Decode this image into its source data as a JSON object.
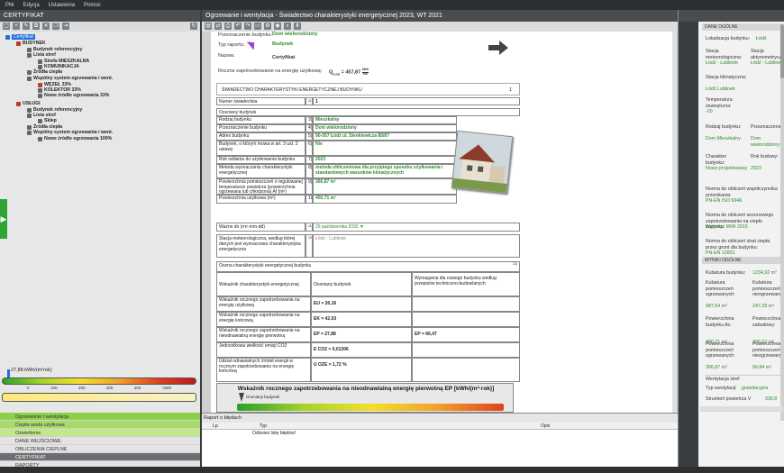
{
  "menubar": [
    "Plik",
    "Edycja",
    "Ustawienia",
    "Pomoc"
  ],
  "left": {
    "title": "CERTYFIKAT",
    "tree": [
      {
        "label": "Certyfikat",
        "indent": 0,
        "bold": false,
        "selected": true,
        "color": "#1e6fd9"
      },
      {
        "label": "BUDYNEK",
        "indent": 1,
        "bold": true,
        "color": "#c0392b"
      },
      {
        "label": "Budynek referencyjny",
        "indent": 2,
        "bold": true,
        "color": "#666"
      },
      {
        "label": "Lista stref",
        "indent": 2,
        "bold": true,
        "color": "#666"
      },
      {
        "label": "Strefa  MIESZKALNA",
        "indent": 3,
        "bold": true,
        "color": "#666"
      },
      {
        "label": "KOMUNIKACJA",
        "indent": 3,
        "bold": true,
        "color": "#666"
      },
      {
        "label": "Źródła ciepła",
        "indent": 2,
        "bold": true,
        "color": "#666"
      },
      {
        "label": "Wspólny system ogrzewania i went.",
        "indent": 2,
        "bold": true,
        "color": "#666"
      },
      {
        "label": "WĘZEŁ 33%",
        "indent": 3,
        "bold": true,
        "color": "#c0392b"
      },
      {
        "label": "KOLEKTOR 33%",
        "indent": 3,
        "bold": true,
        "color": "#666"
      },
      {
        "label": "Nowe źródło ogrzewania 33%",
        "indent": 3,
        "bold": true,
        "color": "#666"
      },
      {
        "label": "USŁUGI",
        "indent": 1,
        "bold": true,
        "color": "#c0392b"
      },
      {
        "label": "Budynek referencyjny",
        "indent": 2,
        "bold": true,
        "color": "#666"
      },
      {
        "label": "Lista stref",
        "indent": 2,
        "bold": true,
        "color": "#666"
      },
      {
        "label": "Sklep",
        "indent": 3,
        "bold": true,
        "color": "#666"
      },
      {
        "label": "Źródła ciepła",
        "indent": 2,
        "bold": true,
        "color": "#666"
      },
      {
        "label": "Wspólny system ogrzewania i went.",
        "indent": 2,
        "bold": true,
        "color": "#666"
      },
      {
        "label": "Nowe źródło ogrzewania 100%",
        "indent": 3,
        "bold": true,
        "color": "#666"
      }
    ],
    "scale_label": "27,88 kWh/(m²rok)",
    "scale_ticks": [
      "0",
      "100",
      "200",
      "300",
      "400",
      ">500"
    ],
    "nav": [
      {
        "label": "Ogrzewanie i wentylacja",
        "style": "g1"
      },
      {
        "label": "Ciepła woda użytkowa",
        "style": "g2"
      },
      {
        "label": "Oświetlenie",
        "style": "g3"
      },
      {
        "label": "DANE WEJŚCIOWE",
        "style": "n"
      },
      {
        "label": "OBLICZENIA CIEPLNE",
        "style": "n"
      },
      {
        "label": "CERTYFIKAT",
        "style": "dk"
      },
      {
        "label": "RAPORTY",
        "style": "n"
      }
    ]
  },
  "main": {
    "title": "Ogrzewanie i wentylacja - Świadectwo charakterystyki energetycznej 2023, WT 2021",
    "fields": {
      "przeznaczenie_label": "Przeznaczenie budynku:",
      "przeznaczenie_value": "Dom wielorodzinny",
      "typ_label": "Typ raportu:",
      "typ_value": "Budynek",
      "nazwa_label": "Nazwa:",
      "nazwa_value": "Certyfikat",
      "roczne_label": "Roczne zapotrzebowanie na energię użytkową:",
      "roczne_value": "Q",
      "roczne_sub": "H,nd",
      "roczne_rest": "= 457,87",
      "roczne_unit_top": "kWh",
      "roczne_unit_bot": "rok"
    },
    "doc": {
      "header_title": "ŚWIADECTWO CHARAKTERYSTYKI ENERGETYCZNEJ BUDYNKU",
      "header_num": "1",
      "numer_label": "Numer świadectwa",
      "numer_idx": "2)",
      "numer_value": "1",
      "oceniany": "Oceniany budynek",
      "rows": [
        {
          "label": "Rodzaj budynku",
          "idx": "3)",
          "value": "Mieszkalny"
        },
        {
          "label": "Przeznaczenie budynku",
          "idx": "4)",
          "value": "Dom wielorodzinny"
        },
        {
          "label": "Adres budynku",
          "idx": "5)",
          "value": "90-057 Łódź ul. Sienkiewicza 85/87"
        },
        {
          "label": "Budynek, o którym mowa w art. 3 ust. 2 ustawy",
          "idx": "6)",
          "value": "Nie"
        },
        {
          "label": "Rok oddania do użytkowania budynku",
          "idx": "7)",
          "value": "2023"
        },
        {
          "label": "Metoda wyznaczania charakterystyki energetycznej",
          "idx": "8)",
          "value": "metoda obliczeniowa dla przyjętego sposobu użytkowania i standardowych warunków klimatycznych"
        },
        {
          "label": "Powierzchnia pomieszczeń o regulowanej temperaturze powietrza (powierzchnia ogrzewana lub chłodzona) Af (m²)",
          "idx": "9)",
          "value": "366,87 m²"
        },
        {
          "label": "Powierzchnia użytkowa (m²)",
          "idx": "10)",
          "value": "450,71 m²"
        }
      ],
      "wazne_label": "Ważne do (rrrr-mm-dd)",
      "wazne_idx": "11)",
      "wazne_value": "25 października 2032",
      "stacja_label": "Stacja meteorologiczna, według której danych jest wyznaczana charakterystyka energetyczna",
      "stacja_idx": "12)",
      "stacja_value": "Łódź - Lublinek",
      "ocena_title": "Ocena charakterystyki energetycznej budynku",
      "ocena_num": "13)",
      "table_head": [
        "Wskaźnik charakterystyki energetycznej",
        "Oceniany budynek",
        "Wymagania dla nowego budynku według przepisów techniczno-budowlanych"
      ],
      "table_rows": [
        {
          "label": "Wskaźnik rocznego zapotrzebowania na energię użytkową",
          "value": "EU = 26,16",
          "req": ""
        },
        {
          "label": "Wskaźnik rocznego zapotrzebowania na energię końcową",
          "value": "EK = 42,03",
          "req": ""
        },
        {
          "label": "Wskaźnik rocznego zapotrzebowania na nieodnawialną energię pierwotną",
          "value": "EP = 27,88",
          "req": "EP = 66,47"
        },
        {
          "label": "Jednostkowa wielkość emisji CO2",
          "value": "E CO2 = 0,01306",
          "req": ""
        },
        {
          "label": "Udział odnawialnych źródeł energii w rocznym zapotrzebowaniu na energię końcową",
          "value": "U OZE = 1,72 %",
          "req": ""
        }
      ],
      "unit": "kWh/(m²rok)",
      "ep_title": "Wskaźnik rocznego zapotrzebowania na nieodnawialną energię pierwotną EP [kWh/(m²·rok)]",
      "ep_sub": "Oceniany budynek"
    }
  },
  "right": {
    "dane_title": "DANE OGÓLNE",
    "lokalizacja_label": "Lokalizacja budynku:",
    "lokalizacja_value": "Łódź",
    "items": [
      {
        "label": "Stacja meteorologiczna:",
        "value": "Łódź - Lublinek"
      },
      {
        "label": "Stacja aktynometryczna:",
        "value": "Łódź - Lublinek"
      },
      {
        "label": "Stacja klimatyczna:",
        "value": "Łódź Lublinek"
      },
      {
        "label": "Temperatura zewnętrzna:",
        "value": "-20"
      },
      {
        "label": "Rodzaj budynku:",
        "value": "Dom Mieszkalny"
      },
      {
        "label": "Przeznaczenie:",
        "value": "Dom wielorodzinny"
      },
      {
        "label": "Charakter budynku:",
        "value": "Nowo projektowany"
      },
      {
        "label": "Rok budowy:",
        "value": "2023"
      },
      {
        "label": "Norma do obliczeń współczynnika przenikania:",
        "value": "PN-EN ISO 6946"
      },
      {
        "label": "Norma do obliczeń sezonowego zapotrzebowania na ciepło budynku:",
        "value": "Wg rozp. MIiR 2015"
      },
      {
        "label": "Norma do obliczeń strat ciepła przez grunt dla budynku:",
        "value": "PN-EN 12831"
      }
    ],
    "wyniki_title": "WYNIKI OGÓLNE",
    "kubatura_label": "Kubatura budynku:",
    "kubatura_value": "1234,92 m³",
    "wyniki": [
      {
        "label": "Kubatura pomieszczeń ogrzewanych:",
        "value": "987,64 m³"
      },
      {
        "label": "Kubatura pomieszczeń nieogrzewanych:",
        "value": "247,28 m³"
      },
      {
        "label": "Powierzchnia budynku Ac:",
        "value": "486,71 m²"
      },
      {
        "label": "Powierzchnia zabudowy:",
        "value": "306,02 m²"
      },
      {
        "label": "Powierzchnia pomieszczeń ogrzewanych:",
        "value": "366,87 m²"
      },
      {
        "label": "Powierzchnia pomieszczeń nieogrzewanych:",
        "value": "99,84 m²"
      }
    ],
    "wentylacja_label": "Wentylacja stref",
    "typ_wentylacji_label": "Typ wentylacji:",
    "typ_wentylacji_value": "grawitacyjna",
    "strumien_label": "Strumień powietrza V",
    "strumien_value": "330,8"
  },
  "log": {
    "title": "Raport o błędach",
    "headers": [
      "Lp.",
      "Typ",
      "Opis"
    ],
    "row": "Odśwież listę błędów!"
  }
}
